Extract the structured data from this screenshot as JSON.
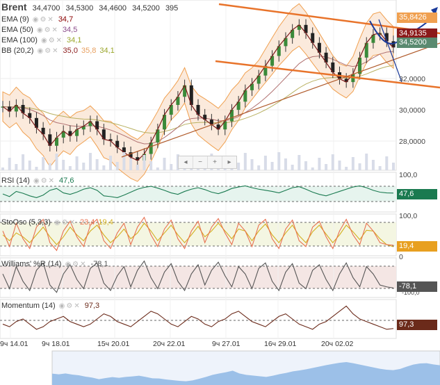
{
  "instrument": {
    "name": "Brent",
    "open": "34,4700",
    "high": "34,5300",
    "low": "34,4600",
    "close": "34,5200",
    "volume": "395"
  },
  "indicators": [
    {
      "label": "EMA (9)",
      "value": "34,7",
      "color": "#8b0000"
    },
    {
      "label": "EMA (50)",
      "value": "34,5",
      "color": "#8b4c8b"
    },
    {
      "label": "EMA (100)",
      "value": "34,1",
      "color": "#9aa62a"
    },
    {
      "label": "BB (20,2)",
      "value": "35,0",
      "value2": "35,8",
      "value3": "34,1",
      "color": "#8b1a1a",
      "color2": "#e8a060",
      "color3": "#9aa62a"
    }
  ],
  "price_axis": {
    "ticks": [
      "32,0000",
      "30,0000",
      "28,0000"
    ],
    "tags": [
      "35,8426",
      "34,9135",
      "34,5200"
    ]
  },
  "rsi": {
    "label": "RSI (14)",
    "value": "47,6",
    "axis_top": "100,0",
    "color": "#1a7a50"
  },
  "stoch": {
    "label": "StoOsc (5,3,3)",
    "k": "23,4",
    "d": "19,4",
    "axis_top": "100,0",
    "axis_bottom": "0",
    "color": "#e87050",
    "color2": "#d4b020"
  },
  "williams": {
    "label": "Williams' %R (14)",
    "value": "-78,1",
    "axis_bottom": "-100,0",
    "color": "#555"
  },
  "momentum": {
    "label": "Momentum (14)",
    "value": "97,3",
    "color": "#6b2a1a"
  },
  "x_labels": [
    "9ч 14.01",
    "9ч 18.01",
    "15ч 20.01",
    "20ч 22.01",
    "9ч 27.01",
    "16ч 29.01",
    "20ч 02.02"
  ],
  "nav": {
    "b1": "◂",
    "b2": "−",
    "b3": "+",
    "b4": "▸"
  },
  "chart_data": {
    "type": "line",
    "title": "Brent",
    "series": [
      {
        "name": "Brent",
        "values": [
          30.9,
          30.6,
          31.0,
          30.5,
          30.2,
          29.6,
          29.2,
          28.5,
          29.0,
          29.4,
          29.1,
          29.5,
          29.7,
          30.0,
          29.5,
          28.9,
          28.8,
          28.4,
          28.1,
          27.8,
          27.6,
          28.0,
          28.7,
          29.5,
          30.4,
          31.0,
          31.5,
          32.2,
          31.0,
          30.4,
          30.1,
          29.8,
          29.5,
          30.0,
          30.7,
          31.2,
          31.9,
          32.3,
          32.8,
          33.4,
          34.0,
          34.6,
          35.1,
          35.6,
          35.9,
          35.4,
          34.8,
          34.2,
          33.6,
          33.0,
          32.6,
          32.4,
          32.9,
          33.9,
          34.8,
          35.3,
          35.4,
          34.9,
          34.52
        ]
      }
    ],
    "xlabel": "",
    "ylabel": "",
    "ylim": [
      27.0,
      37.0
    ],
    "rsi": [
      45,
      38,
      52,
      47,
      40,
      35,
      42,
      55,
      60,
      48,
      44,
      50,
      58,
      62,
      55,
      40,
      38,
      35,
      42,
      50,
      58,
      63,
      66,
      61,
      55,
      48,
      44,
      52,
      58,
      62,
      57,
      50,
      46,
      52,
      60,
      64,
      67,
      62,
      58,
      55,
      52,
      48,
      55,
      62,
      65,
      58,
      50,
      44,
      40,
      46,
      52,
      58,
      64,
      67,
      62,
      55,
      50,
      48,
      47.6
    ],
    "stoch_k": [
      60,
      20,
      80,
      40,
      15,
      70,
      90,
      30,
      10,
      60,
      85,
      45,
      20,
      75,
      90,
      35,
      15,
      55,
      80,
      25,
      70,
      95,
      50,
      20,
      65,
      88,
      40,
      15,
      60,
      85,
      30,
      70,
      92,
      55,
      25,
      80,
      60,
      20,
      75,
      90,
      40,
      15,
      65,
      88,
      35,
      20,
      70,
      85,
      45,
      15,
      60,
      90,
      50,
      25,
      80,
      60,
      30,
      25,
      23.4
    ],
    "stoch_d": [
      50,
      35,
      55,
      45,
      30,
      50,
      70,
      45,
      25,
      45,
      70,
      50,
      35,
      60,
      75,
      50,
      30,
      45,
      65,
      40,
      55,
      80,
      60,
      35,
      55,
      75,
      50,
      30,
      50,
      72,
      45,
      60,
      80,
      60,
      40,
      65,
      60,
      35,
      60,
      78,
      50,
      30,
      55,
      75,
      48,
      30,
      58,
      75,
      52,
      30,
      50,
      75,
      58,
      38,
      62,
      60,
      40,
      25,
      19.4
    ],
    "williams": [
      -40,
      -80,
      -20,
      -60,
      -85,
      -30,
      -10,
      -70,
      -90,
      -40,
      -15,
      -55,
      -80,
      -25,
      -10,
      -65,
      -85,
      -45,
      -20,
      -75,
      -30,
      -5,
      -50,
      -80,
      -35,
      -12,
      -60,
      -85,
      -40,
      -15,
      -70,
      -30,
      -8,
      -45,
      -75,
      -20,
      -40,
      -80,
      -25,
      -10,
      -60,
      -85,
      -35,
      -12,
      -65,
      -80,
      -30,
      -15,
      -55,
      -85,
      -40,
      -10,
      -50,
      -75,
      -20,
      -40,
      -70,
      -75,
      -78.1
    ],
    "momentum": [
      99,
      98,
      100,
      101,
      99,
      97,
      98,
      100,
      101,
      102,
      100,
      99,
      98,
      99,
      101,
      103,
      102,
      100,
      99,
      98,
      100,
      102,
      104,
      103,
      101,
      99,
      98,
      100,
      102,
      101,
      99,
      98,
      100,
      101,
      103,
      104,
      102,
      100,
      99,
      98,
      100,
      102,
      103,
      101,
      99,
      98,
      97,
      99,
      100,
      102,
      104,
      106,
      103,
      101,
      100,
      99,
      98,
      97,
      97.3
    ]
  }
}
